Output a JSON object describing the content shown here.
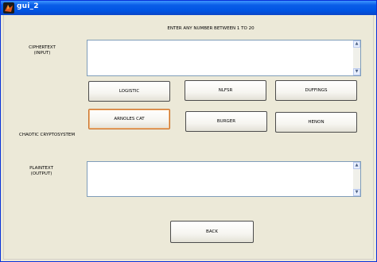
{
  "window": {
    "title": "gui_2"
  },
  "instruction": "ENTER ANY NUMBER BETWEEN 1 TO 20",
  "ciphertext": {
    "label_line1": "CIPHERTEXT",
    "label_line2": "(INPUT)",
    "value": ""
  },
  "plaintext": {
    "label_line1": "PLAINTEXT",
    "label_line2": "(OUTPUT)",
    "value": ""
  },
  "system_label": "CHAOTIC CRYPTOSYSTEM",
  "buttons": {
    "logistic": "LOGISTIC",
    "nlfsr": "NLFSR",
    "duffings": "DUFFINGS",
    "arnoles_cat": "ARNOLES CAT",
    "burger": "BURGER",
    "henon": "HENON",
    "back": "BACK"
  },
  "icons": {
    "app": "matlab-logo-icon",
    "scroll_up": "scroll-up-arrow-icon",
    "scroll_down": "scroll-down-arrow-icon"
  },
  "colors": {
    "titlebar": "#0054e3",
    "window_bg": "#ece9d8",
    "focus_border": "#c9712b"
  }
}
